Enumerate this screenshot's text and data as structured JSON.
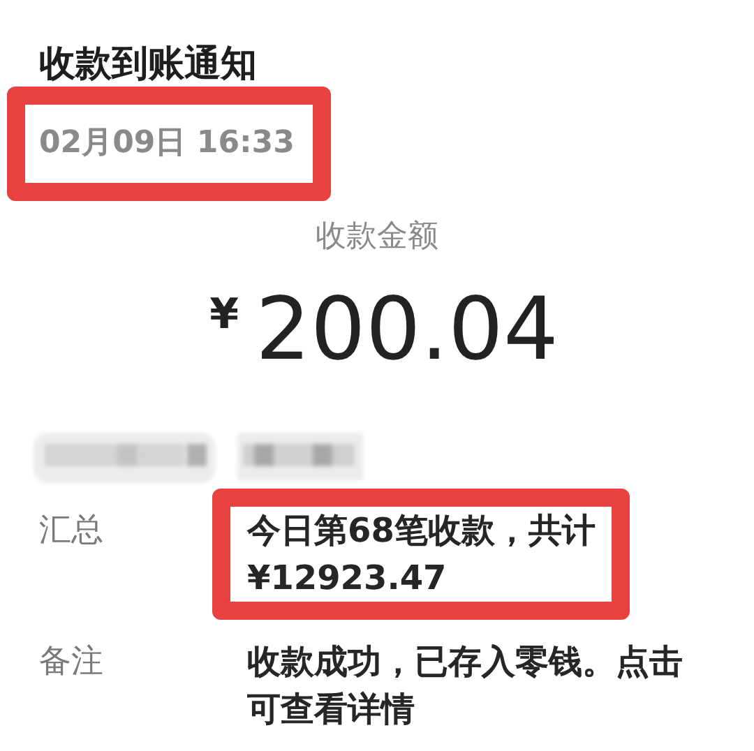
{
  "title": "收款到账通知",
  "time": {
    "text": "02月09日 16:33",
    "highlighted": true
  },
  "amount_label": "收款金额",
  "amount": {
    "currency": "¥",
    "value": "200.04"
  },
  "rows": [
    {
      "kind": "redacted"
    },
    {
      "kind": "text",
      "label": "汇总",
      "lines": [
        "今日第68笔收款，共计",
        "¥12923.47"
      ],
      "highlighted": true
    },
    {
      "kind": "text",
      "label": "备注",
      "lines": [
        "收款成功，已存入零钱。点击",
        "可查看详情"
      ],
      "highlighted": false
    }
  ]
}
